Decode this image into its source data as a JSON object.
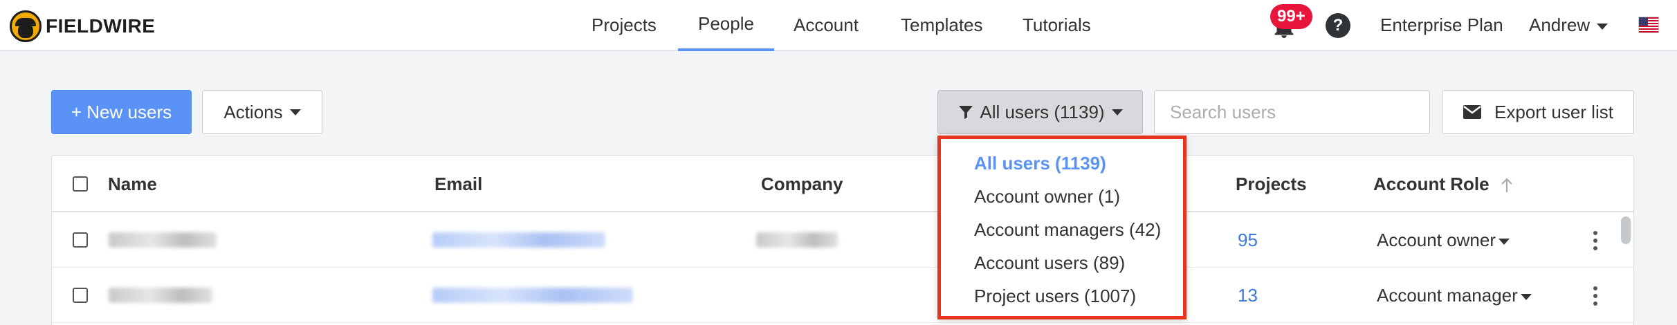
{
  "app": {
    "logo_text": "FIELDWIRE"
  },
  "nav": {
    "tabs": [
      {
        "label": "Projects"
      },
      {
        "label": "People",
        "active": true
      },
      {
        "label": "Account"
      },
      {
        "label": "Templates"
      },
      {
        "label": "Tutorials"
      }
    ],
    "notifications_badge": "99+",
    "help_label": "?",
    "plan_label": "Enterprise Plan",
    "user_name": "Andrew"
  },
  "toolbar": {
    "new_users_label": "+ New users",
    "actions_label": "Actions",
    "filter_label": "All users (1139)",
    "search_placeholder": "Search users",
    "export_label": "Export user list"
  },
  "filter_dropdown": {
    "options": [
      {
        "label": "All users (1139)",
        "selected": true
      },
      {
        "label": "Account owner (1)"
      },
      {
        "label": "Account managers (42)"
      },
      {
        "label": "Account users (89)"
      },
      {
        "label": "Project users (1007)"
      }
    ]
  },
  "table": {
    "columns": [
      "Name",
      "Email",
      "Company",
      "Projects",
      "Account Role"
    ],
    "rows": [
      {
        "projects": "95",
        "role": "Account owner"
      },
      {
        "projects": "13",
        "role": "Account manager"
      }
    ]
  },
  "colors": {
    "primary": "#5a93f5",
    "badge": "#e8143c",
    "highlight_border": "#e8341f",
    "link": "#3d79d8"
  }
}
